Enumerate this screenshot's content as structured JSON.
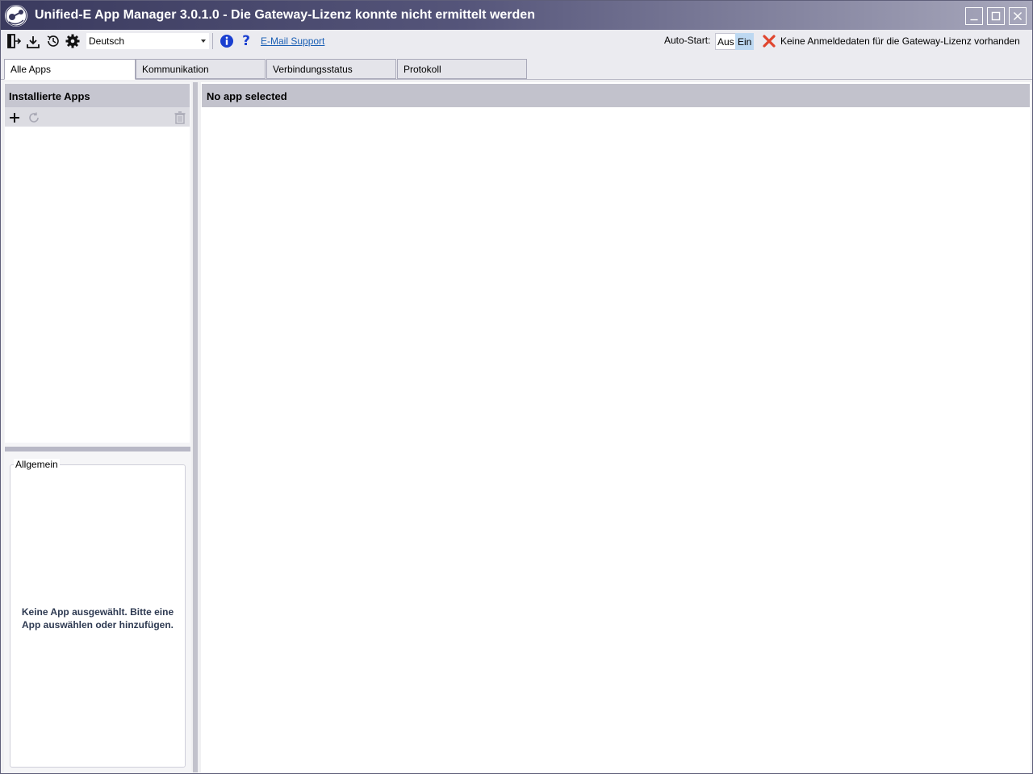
{
  "window": {
    "title": "Unified-E App Manager 3.0.1.0 - Die Gateway-Lizenz konnte nicht ermittelt werden"
  },
  "toolbar": {
    "icons": [
      "logout-icon",
      "download-icon",
      "history-icon",
      "settings-icon",
      "info-icon",
      "help-icon"
    ],
    "language": "Deutsch",
    "email_support": "E-Mail Support",
    "autostart_label": "Auto-Start:",
    "autostart_off": "Aus",
    "autostart_on": "Ein",
    "autostart_selected": "Ein",
    "license_status": "Keine Anmeldedaten für die Gateway-Lizenz vorhanden"
  },
  "tabs": [
    {
      "label": "Alle Apps",
      "active": true
    },
    {
      "label": "Kommunikation",
      "active": false
    },
    {
      "label": "Verbindungsstatus",
      "active": false
    },
    {
      "label": "Protokoll",
      "active": false
    }
  ],
  "left_panel": {
    "title": "Installierte Apps",
    "general_title": "Allgemein",
    "general_message": "Keine App ausgewählt. Bitte eine App auswählen oder hinzufügen."
  },
  "right_panel": {
    "title": "No app selected"
  },
  "colors": {
    "accent_blue": "#1a5fb4",
    "title_gradient_start": "#3a3a5e",
    "selected_segment": "#bdd8f1",
    "error_red": "#e0452e"
  }
}
